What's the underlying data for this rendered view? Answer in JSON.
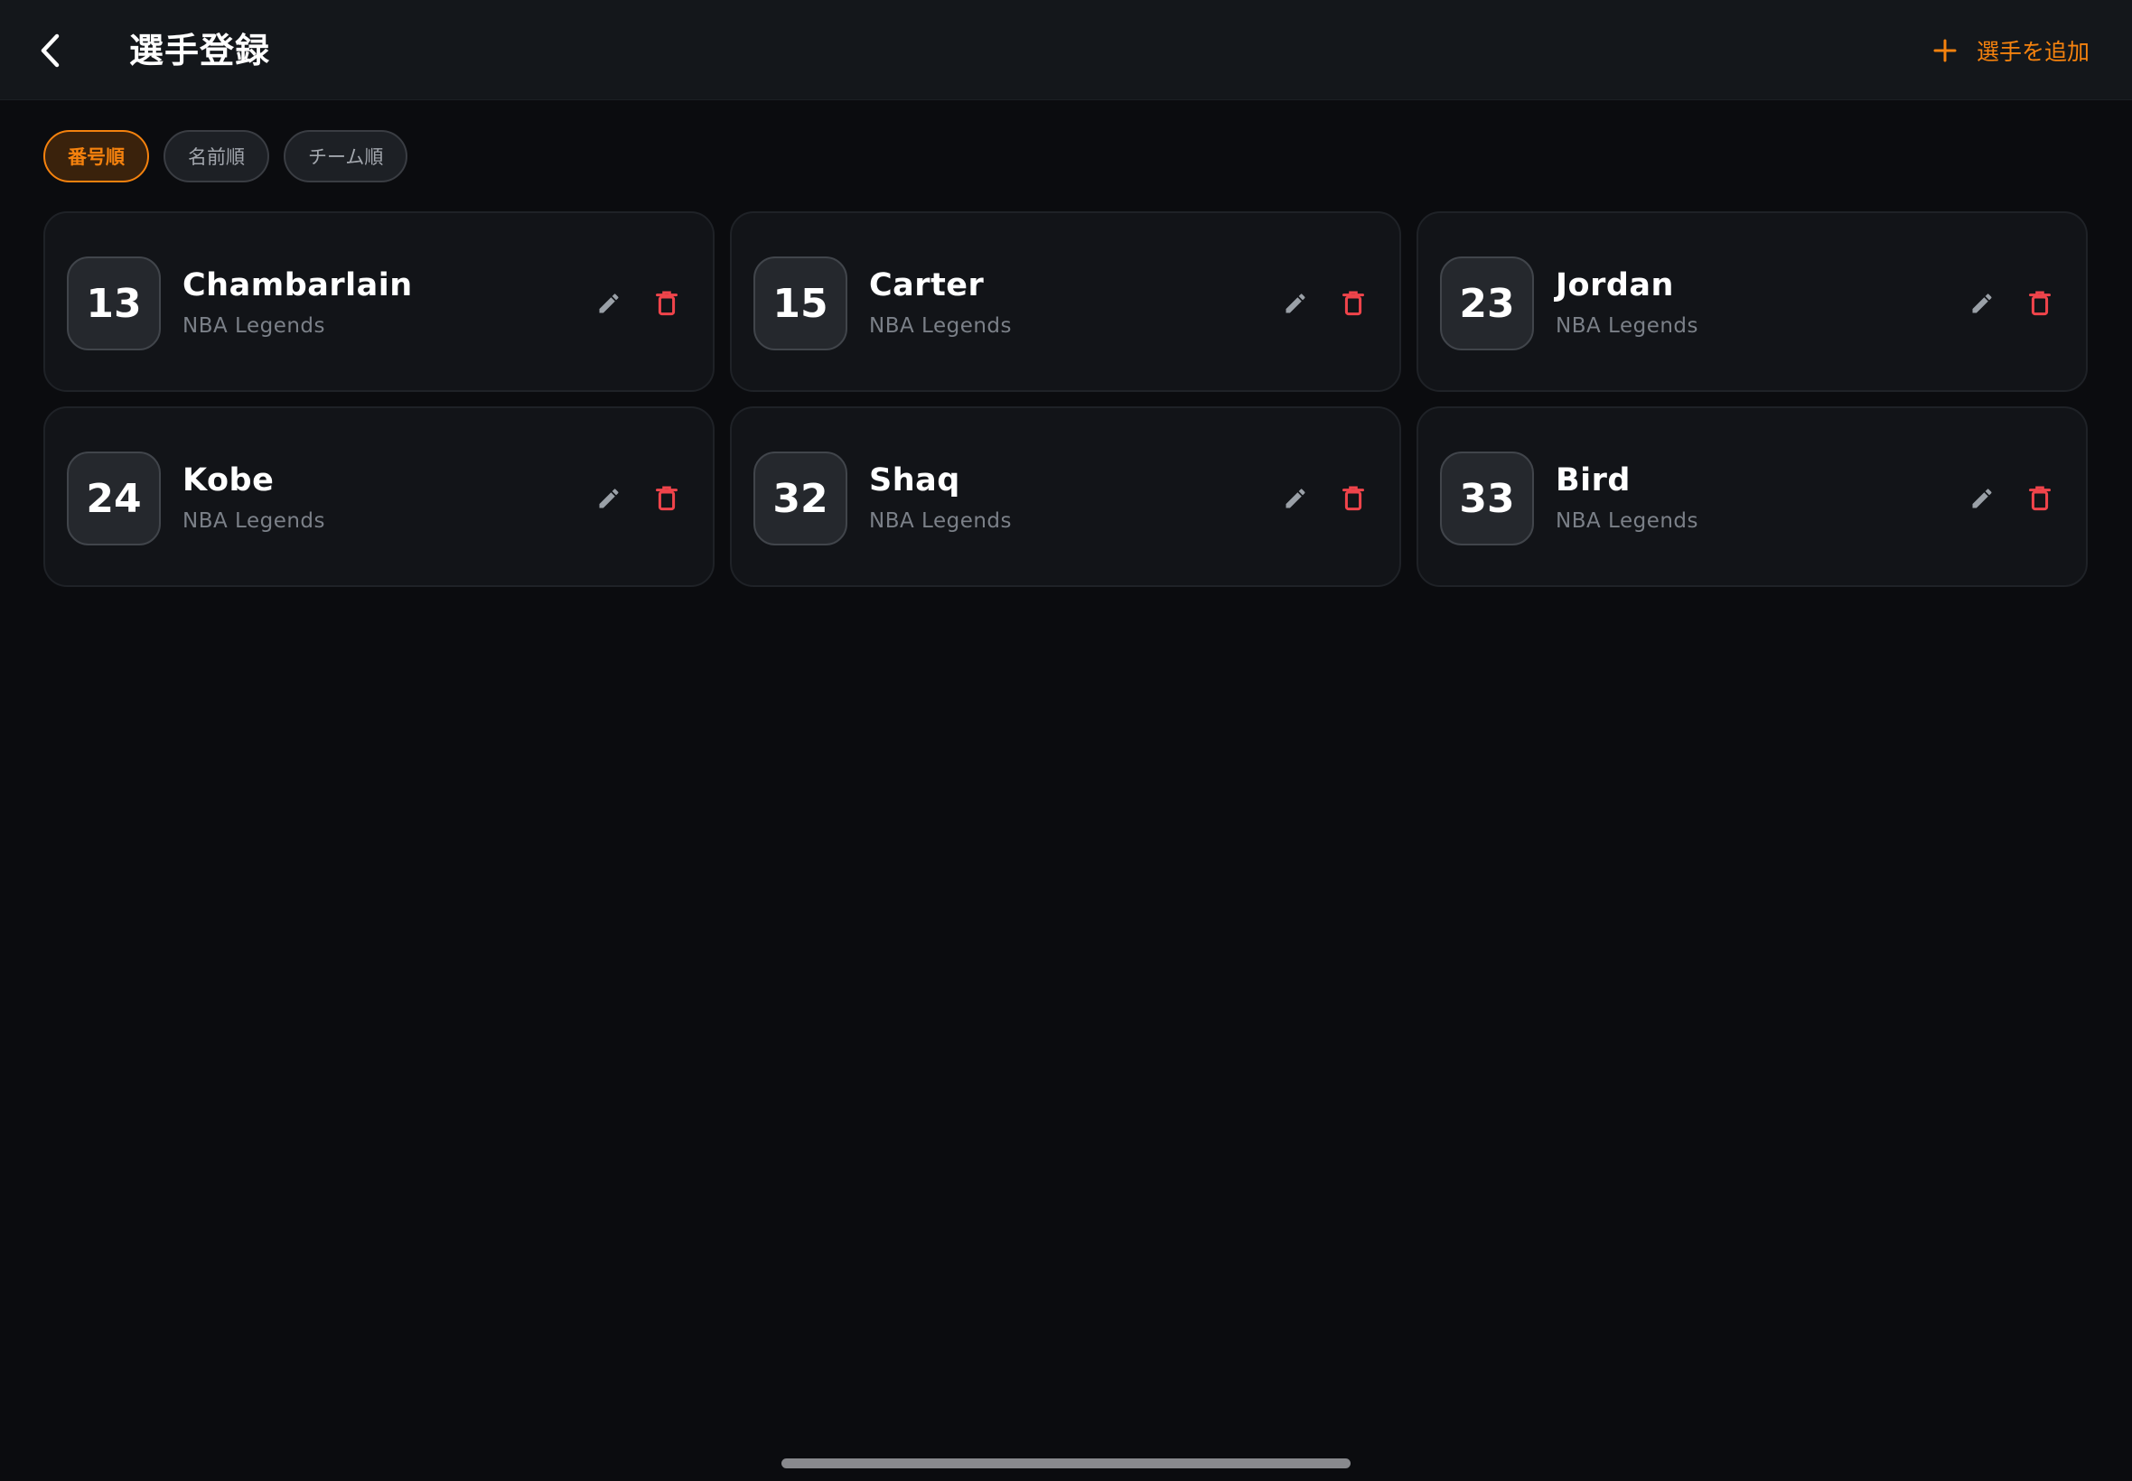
{
  "header": {
    "title": "選手登録",
    "back_icon": "chevron-left-icon",
    "add_label": "選手を追加",
    "add_icon": "plus-icon"
  },
  "sort_filters": [
    {
      "label": "番号順",
      "active": true
    },
    {
      "label": "名前順",
      "active": false
    },
    {
      "label": "チーム順",
      "active": false
    }
  ],
  "players": [
    {
      "number": "13",
      "name": "Chambarlain",
      "team": "NBA Legends"
    },
    {
      "number": "15",
      "name": "Carter",
      "team": "NBA Legends"
    },
    {
      "number": "23",
      "name": "Jordan",
      "team": "NBA Legends"
    },
    {
      "number": "24",
      "name": "Kobe",
      "team": "NBA Legends"
    },
    {
      "number": "32",
      "name": "Shaq",
      "team": "NBA Legends"
    },
    {
      "number": "33",
      "name": "Bird",
      "team": "NBA Legends"
    }
  ],
  "colors": {
    "background": "#0b0c0f",
    "header": "#14171b",
    "accent": "#f5820e",
    "delete": "#f0444b",
    "edit": "#9aa0a7"
  }
}
